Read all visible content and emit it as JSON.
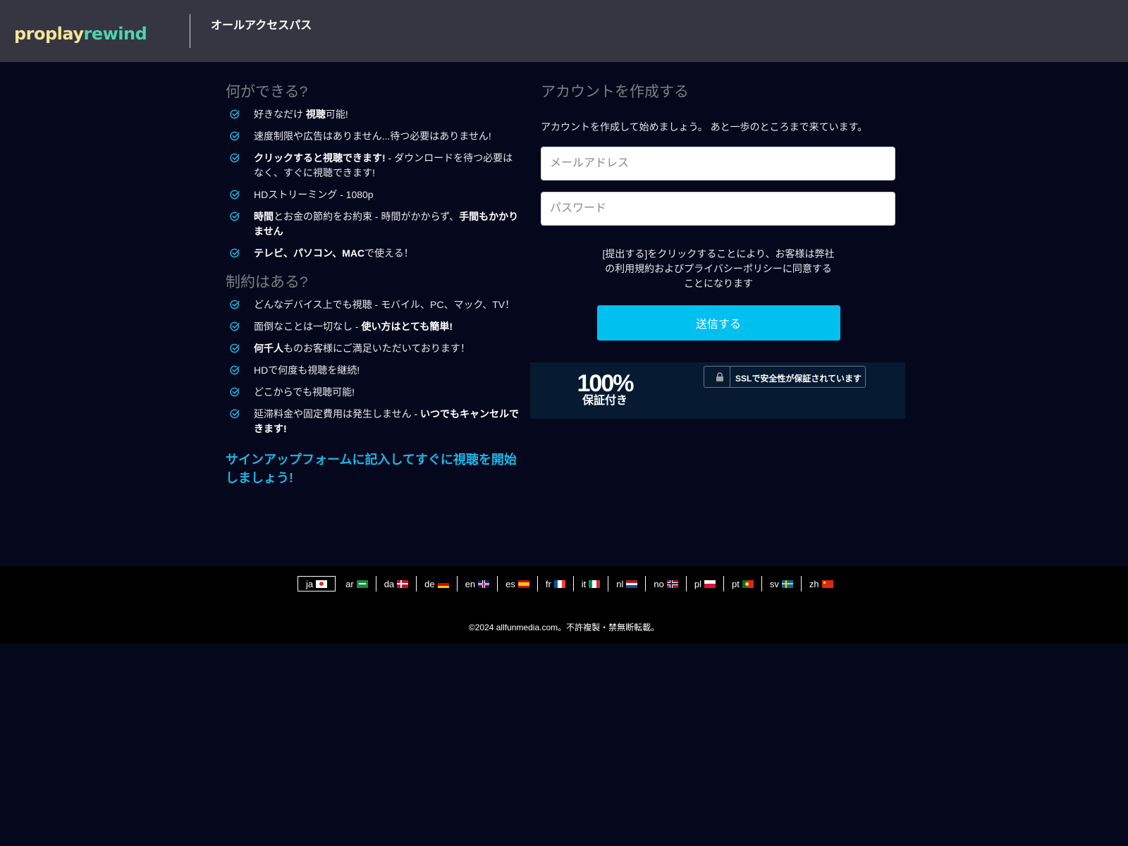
{
  "header": {
    "logo_part1": "proplay",
    "logo_part2": "rewind",
    "title": "オールアクセスパス"
  },
  "features": {
    "title": "何ができる?",
    "items": [
      {
        "parts": [
          {
            "t": "好きなだけ ",
            "b": false
          },
          {
            "t": "視聴",
            "b": true
          },
          {
            "t": "可能!",
            "b": false
          }
        ]
      },
      {
        "parts": [
          {
            "t": "速度制限や広告はありません...待つ必要はありません!",
            "b": false
          }
        ]
      },
      {
        "parts": [
          {
            "t": "クリックすると視聴できます!",
            "b": true
          },
          {
            "t": " - ダウンロードを待つ必要はなく、すぐに視聴できます!",
            "b": false
          }
        ]
      },
      {
        "parts": [
          {
            "t": "HDストリーミング - 1080p",
            "b": false
          }
        ]
      },
      {
        "parts": [
          {
            "t": "時間",
            "b": true
          },
          {
            "t": "とお金の節約をお約束 - 時間がかからず、",
            "b": false
          },
          {
            "t": "手間もかかりません",
            "b": true
          }
        ]
      },
      {
        "parts": [
          {
            "t": "テレビ、パソコン、MAC",
            "b": true
          },
          {
            "t": "で使える！",
            "b": false
          }
        ]
      }
    ]
  },
  "restrictions": {
    "title": "制約はある?",
    "items": [
      {
        "parts": [
          {
            "t": "どんなデバイス上でも視聴 - モバイル、PC、マック、TV！",
            "b": false
          }
        ]
      },
      {
        "parts": [
          {
            "t": "面倒なことは一切なし - ",
            "b": false
          },
          {
            "t": "使い方はとても簡単!",
            "b": true
          }
        ]
      },
      {
        "parts": [
          {
            "t": "何千人",
            "b": true
          },
          {
            "t": "ものお客様にご満足いただいております！",
            "b": false
          }
        ]
      },
      {
        "parts": [
          {
            "t": "HDで何度も視聴を継続!",
            "b": false
          }
        ]
      },
      {
        "parts": [
          {
            "t": "どこからでも視聴可能!",
            "b": false
          }
        ]
      },
      {
        "parts": [
          {
            "t": "延滞料金や固定費用は発生しません - ",
            "b": false
          },
          {
            "t": "いつでもキャンセルできます!",
            "b": true
          }
        ]
      }
    ]
  },
  "cta": "サインアップフォームに記入してすぐに視聴を開始しましょう!",
  "form": {
    "title": "アカウントを作成する",
    "subtitle": "アカウントを作成して始めましょう。 あと一歩のところまで来ています。",
    "email_placeholder": "メールアドレス",
    "password_placeholder": "パスワード",
    "terms": "[提出する]をクリックすることにより、お客様は弊社の利用規約およびプライバシーポリシーに同意することになります",
    "submit_label": "送信する"
  },
  "trust": {
    "percent": "100%",
    "guarantee": "保証付き",
    "ssl_text": "SSLで安全性が保証されています"
  },
  "footer": {
    "languages": [
      {
        "code": "ja",
        "flag": "jp",
        "active": true
      },
      {
        "code": "ar",
        "flag": "sa"
      },
      {
        "code": "da",
        "flag": "dk"
      },
      {
        "code": "de",
        "flag": "de"
      },
      {
        "code": "en",
        "flag": "gb"
      },
      {
        "code": "es",
        "flag": "es"
      },
      {
        "code": "fr",
        "flag": "fr"
      },
      {
        "code": "it",
        "flag": "it"
      },
      {
        "code": "nl",
        "flag": "nl"
      },
      {
        "code": "no",
        "flag": "no"
      },
      {
        "code": "pl",
        "flag": "pl"
      },
      {
        "code": "pt",
        "flag": "pt"
      },
      {
        "code": "sv",
        "flag": "se"
      },
      {
        "code": "zh",
        "flag": "cn"
      }
    ],
    "copyright": "©2024 allfunmedia.com。不許複製・禁無断転載。"
  },
  "colors": {
    "background": "#05071c",
    "header": "#353641",
    "accent": "#00c0f0",
    "check": "#1fb6e6",
    "logo_yellow": "#f3e49a",
    "logo_teal": "#4fd2b0"
  }
}
